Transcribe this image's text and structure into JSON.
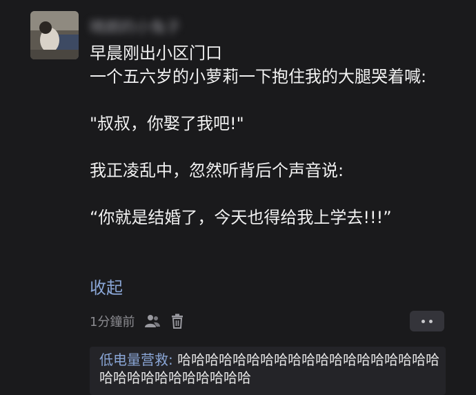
{
  "comment": {
    "username": "晴朗的小兔子",
    "lines": [
      "早晨刚出小区门口",
      "一个五六岁的小萝莉一下抱住我的大腿哭着喊:",
      "",
      "\"叔叔，你娶了我吧!\"",
      "",
      "我正凌乱中，忽然听背后个声音说:",
      "",
      "“你就是结婚了，今天也得给我上学去!!!”"
    ],
    "collapse_label": "收起",
    "time": "1分鐘前"
  },
  "reply": {
    "author": "低电量营救:",
    "text": "哈哈哈哈哈哈哈哈哈哈哈哈哈哈哈哈哈哈哈哈哈哈哈哈哈哈哈哈哈哈"
  },
  "icons": {
    "like": "users-icon",
    "delete": "trash-icon",
    "more": "more-dots-icon"
  },
  "colors": {
    "background": "#1a1a1c",
    "link": "#8aa6d6",
    "muted": "#8b8b90"
  }
}
